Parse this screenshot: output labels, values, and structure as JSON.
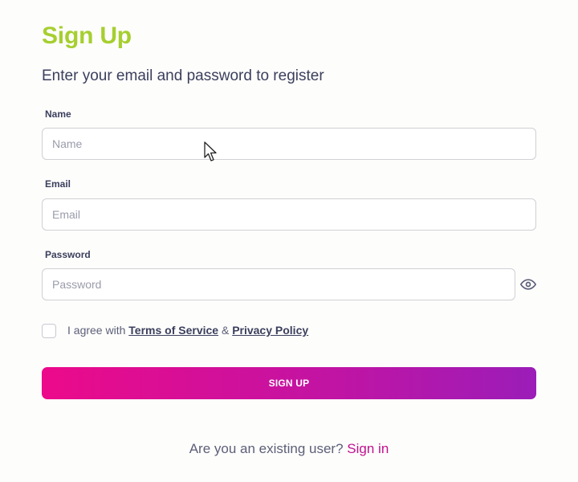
{
  "header": {
    "title": "Sign Up",
    "subtitle": "Enter your email and password to register"
  },
  "form": {
    "name": {
      "label": "Name",
      "placeholder": "Name",
      "value": ""
    },
    "email": {
      "label": "Email",
      "placeholder": "Email",
      "value": ""
    },
    "password": {
      "label": "Password",
      "placeholder": "Password",
      "value": ""
    },
    "agreement": {
      "checked": false,
      "prefix": "I agree with",
      "terms": "Terms of Service",
      "separator": "&",
      "privacy": "Privacy Policy"
    },
    "submit_label": "SIGN UP"
  },
  "footer": {
    "prompt": "Are you an existing user?",
    "link": "Sign in"
  },
  "icons": {
    "password_toggle": "eye-icon",
    "pointer": "mouse-cursor-icon"
  },
  "colors": {
    "title": "#a6cf2f",
    "button_gradient_start": "#ec0a8a",
    "button_gradient_end": "#9b1db8",
    "link": "#c0128d"
  }
}
